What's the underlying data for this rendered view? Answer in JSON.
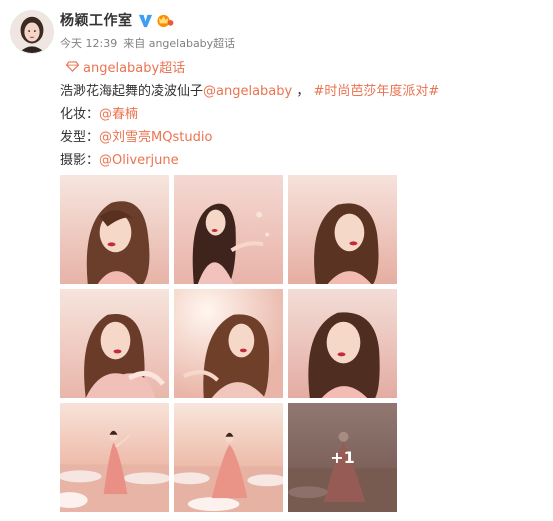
{
  "post": {
    "author": "杨颖工作室",
    "time": "今天 12:39",
    "source": "来自 angelababy超话",
    "topic_chip": "angelababy超话",
    "line1": {
      "text_a": "浩渺花海起舞的凌波仙子",
      "mention": "@angelababy",
      "sep": " ，",
      "hashtag": "#时尚芭莎年度派对#"
    },
    "makeup": {
      "label": "化妆：",
      "value": "@春楠"
    },
    "hair": {
      "label": "发型：",
      "value": "@刘雪亮MQstudio"
    },
    "photo": {
      "label": "摄影：",
      "value": "@Oliverjune"
    },
    "more_photos": "+1"
  },
  "colors": {
    "link": "#eb7350",
    "verified": "#3e9ef3",
    "vip": "#ff8c00"
  },
  "icons": [
    "verified-icon",
    "vip-icon",
    "diamond-icon"
  ]
}
